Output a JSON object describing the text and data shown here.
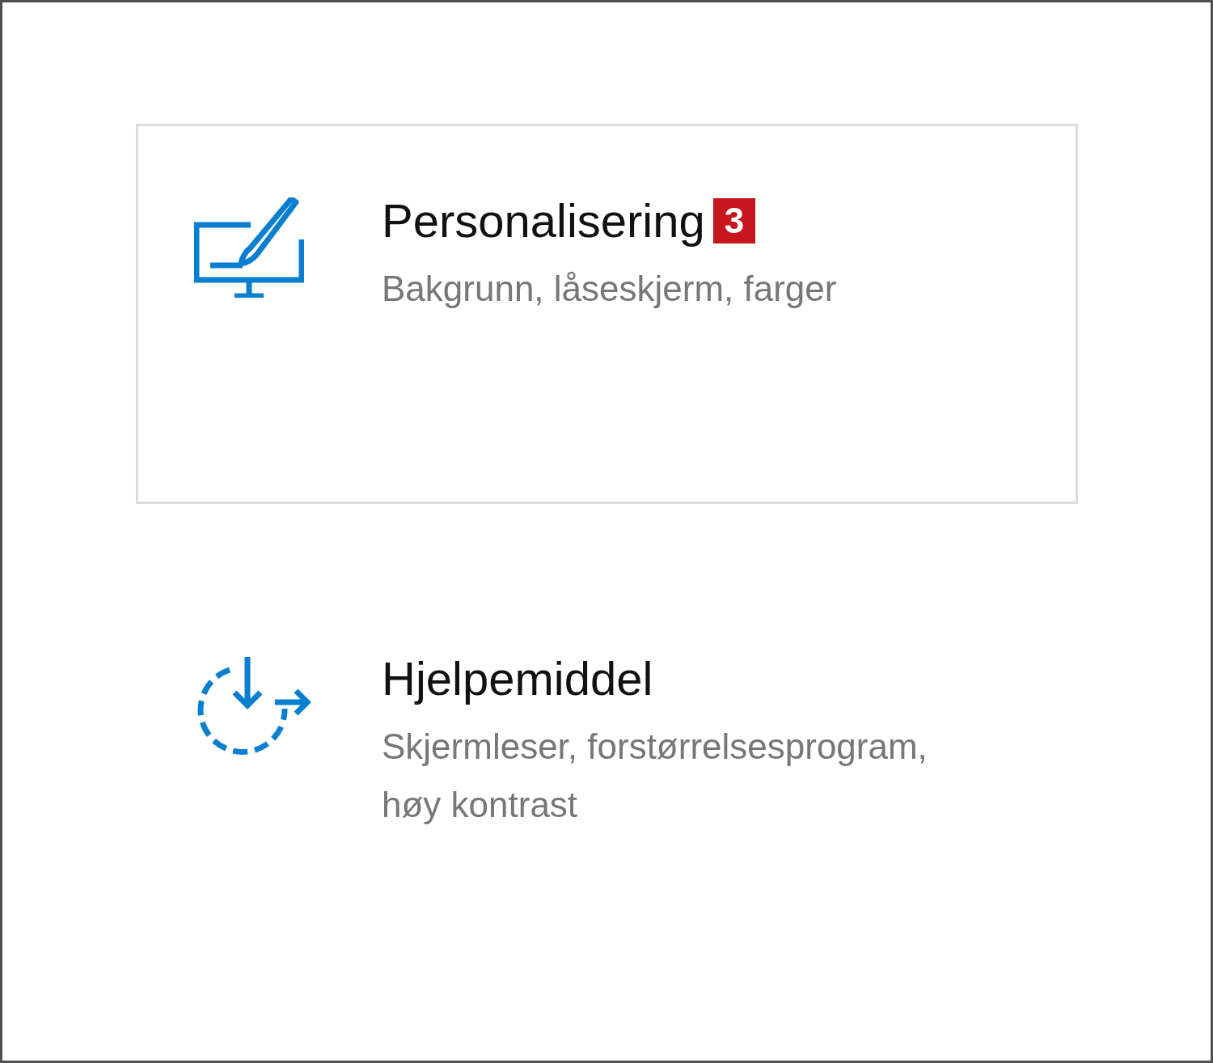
{
  "tiles": [
    {
      "title": "Personalisering",
      "badge": "3",
      "description": "Bakgrunn, låseskjerm, farger",
      "selected": true
    },
    {
      "title": "Hjelpemiddel",
      "description": "Skjermleser, forstørrelsesprogram, høy kontrast",
      "selected": false
    }
  ]
}
